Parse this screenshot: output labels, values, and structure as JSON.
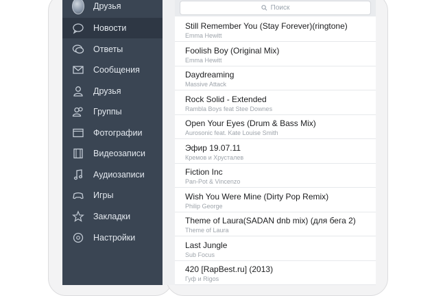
{
  "sidebar": {
    "items": [
      {
        "label": "Друзья",
        "icon": "avatar",
        "active": false
      },
      {
        "label": "Новости",
        "icon": "news-icon",
        "active": true
      },
      {
        "label": "Ответы",
        "icon": "replies-icon",
        "active": false
      },
      {
        "label": "Сообщения",
        "icon": "messages-icon",
        "active": false
      },
      {
        "label": "Друзья",
        "icon": "friends-icon",
        "active": false
      },
      {
        "label": "Группы",
        "icon": "groups-icon",
        "active": false
      },
      {
        "label": "Фотографии",
        "icon": "photos-icon",
        "active": false
      },
      {
        "label": "Видеозаписи",
        "icon": "videos-icon",
        "active": false
      },
      {
        "label": "Аудиозаписи",
        "icon": "audio-icon",
        "active": false
      },
      {
        "label": "Игры",
        "icon": "games-icon",
        "active": false
      },
      {
        "label": "Закладки",
        "icon": "bookmarks-icon",
        "active": false
      },
      {
        "label": "Настройки",
        "icon": "settings-icon",
        "active": false
      }
    ]
  },
  "search": {
    "placeholder": "Поиск"
  },
  "tracks": [
    {
      "title": "Still Remember You (Stay Forever)(ringtone)",
      "artist": "Emma Hewitt"
    },
    {
      "title": "Foolish Boy (Original Mix)",
      "artist": "Emma Hewitt"
    },
    {
      "title": "Daydreaming",
      "artist": "Massive Attack"
    },
    {
      "title": "Rock Solid - Extended",
      "artist": "Rambla Boys feat Stee Downes"
    },
    {
      "title": "Open Your Eyes (Drum & Bass Mix)",
      "artist": "Aurosonic feat. Kate Louise Smith"
    },
    {
      "title": "Эфир 19.07.11",
      "artist": "Кремов и Хрусталев"
    },
    {
      "title": "Fiction Inc",
      "artist": "Pan-Pot & Vincenzo"
    },
    {
      "title": "Wish You Were Mine (Dirty Pop Remix)",
      "artist": "Philip George"
    },
    {
      "title": "Theme of Laura(SADAN dnb mix) (для бега 2)",
      "artist": "Theme of Laura"
    },
    {
      "title": "Last Jungle",
      "artist": "Sub Focus"
    },
    {
      "title": "420 [RapBest.ru] (2013)",
      "artist": "Гуф и Rigos"
    }
  ],
  "colors": {
    "sidebar_bg": "#3a4553",
    "sidebar_active": "#2e3744",
    "title_text": "#1b1c1e",
    "artist_text": "#9ea4ab"
  }
}
